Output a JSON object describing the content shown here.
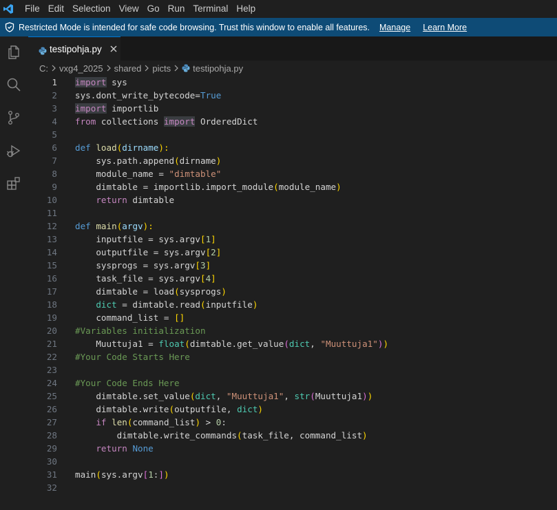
{
  "menubar": {
    "items": [
      "File",
      "Edit",
      "Selection",
      "View",
      "Go",
      "Run",
      "Terminal",
      "Help"
    ]
  },
  "banner": {
    "text": "Restricted Mode is intended for safe code browsing. Trust this window to enable all features.",
    "manage": "Manage",
    "learn_more": "Learn More"
  },
  "tab": {
    "label": "testipohja.py"
  },
  "breadcrumb": {
    "items": [
      "C:",
      "vxg4_2025",
      "shared",
      "picts"
    ],
    "file": "testipohja.py"
  },
  "editor": {
    "active_line": 1,
    "lines": [
      {
        "n": "1",
        "tokens": [
          [
            "kwhl",
            "import"
          ],
          [
            "plain",
            " sys"
          ]
        ]
      },
      {
        "n": "2",
        "tokens": [
          [
            "plain",
            "sys.dont_write_bytecode="
          ],
          [
            "kw2",
            "True"
          ]
        ]
      },
      {
        "n": "3",
        "tokens": [
          [
            "kwhl",
            "import"
          ],
          [
            "plain",
            " importlib"
          ]
        ]
      },
      {
        "n": "4",
        "tokens": [
          [
            "kw",
            "from"
          ],
          [
            "plain",
            " collections "
          ],
          [
            "kwhl",
            "import"
          ],
          [
            "plain",
            " OrderedDict"
          ]
        ]
      },
      {
        "n": "5",
        "tokens": []
      },
      {
        "n": "6",
        "tokens": [
          [
            "def",
            "def"
          ],
          [
            "plain",
            " "
          ],
          [
            "fn",
            "load"
          ],
          [
            "p1",
            "("
          ],
          [
            "var",
            "dirname"
          ],
          [
            "p1",
            "):"
          ]
        ]
      },
      {
        "n": "7",
        "tokens": [
          [
            "plain",
            "    sys.path.append"
          ],
          [
            "p1",
            "("
          ],
          [
            "plain",
            "dirname"
          ],
          [
            "p1",
            ")"
          ]
        ]
      },
      {
        "n": "8",
        "tokens": [
          [
            "plain",
            "    module_name = "
          ],
          [
            "str",
            "\"dimtable\""
          ]
        ]
      },
      {
        "n": "9",
        "tokens": [
          [
            "plain",
            "    dimtable = importlib.import_module"
          ],
          [
            "p1",
            "("
          ],
          [
            "plain",
            "module_name"
          ],
          [
            "p1",
            ")"
          ]
        ]
      },
      {
        "n": "10",
        "tokens": [
          [
            "plain",
            "    "
          ],
          [
            "kw",
            "return"
          ],
          [
            "plain",
            " dimtable"
          ]
        ]
      },
      {
        "n": "11",
        "tokens": []
      },
      {
        "n": "12",
        "tokens": [
          [
            "def",
            "def"
          ],
          [
            "plain",
            " "
          ],
          [
            "fn",
            "main"
          ],
          [
            "p1",
            "("
          ],
          [
            "var",
            "argv"
          ],
          [
            "p1",
            "):"
          ]
        ]
      },
      {
        "n": "13",
        "tokens": [
          [
            "plain",
            "    inputfile = sys.argv"
          ],
          [
            "p1",
            "["
          ],
          [
            "num",
            "1"
          ],
          [
            "p1",
            "]"
          ]
        ]
      },
      {
        "n": "14",
        "tokens": [
          [
            "plain",
            "    outputfile = sys.argv"
          ],
          [
            "p1",
            "["
          ],
          [
            "num",
            "2"
          ],
          [
            "p1",
            "]"
          ]
        ]
      },
      {
        "n": "15",
        "tokens": [
          [
            "plain",
            "    sysprogs = sys.argv"
          ],
          [
            "p1",
            "["
          ],
          [
            "num",
            "3"
          ],
          [
            "p1",
            "]"
          ]
        ]
      },
      {
        "n": "16",
        "tokens": [
          [
            "plain",
            "    task_file = sys.argv"
          ],
          [
            "p1",
            "["
          ],
          [
            "num",
            "4"
          ],
          [
            "p1",
            "]"
          ]
        ]
      },
      {
        "n": "17",
        "tokens": [
          [
            "plain",
            "    dimtable = load"
          ],
          [
            "p1",
            "("
          ],
          [
            "plain",
            "sysprogs"
          ],
          [
            "p1",
            ")"
          ]
        ]
      },
      {
        "n": "18",
        "tokens": [
          [
            "plain",
            "    "
          ],
          [
            "builtin",
            "dict"
          ],
          [
            "plain",
            " = dimtable.read"
          ],
          [
            "p1",
            "("
          ],
          [
            "plain",
            "inputfile"
          ],
          [
            "p1",
            ")"
          ]
        ]
      },
      {
        "n": "19",
        "tokens": [
          [
            "plain",
            "    command_list = "
          ],
          [
            "p1",
            "[]"
          ]
        ]
      },
      {
        "n": "20",
        "tokens": [
          [
            "cm",
            "#Variables initialization"
          ]
        ]
      },
      {
        "n": "21",
        "tokens": [
          [
            "plain",
            "    Muuttuja1 = "
          ],
          [
            "builtin",
            "float"
          ],
          [
            "p1",
            "("
          ],
          [
            "plain",
            "dimtable.get_value"
          ],
          [
            "p2",
            "("
          ],
          [
            "builtin",
            "dict"
          ],
          [
            "plain",
            ", "
          ],
          [
            "str",
            "\"Muuttuja1\""
          ],
          [
            "p2",
            ")"
          ],
          [
            "p1",
            ")"
          ]
        ]
      },
      {
        "n": "22",
        "tokens": [
          [
            "cm",
            "#Your Code Starts Here"
          ]
        ]
      },
      {
        "n": "23",
        "tokens": []
      },
      {
        "n": "24",
        "tokens": [
          [
            "cm",
            "#Your Code Ends Here"
          ]
        ]
      },
      {
        "n": "25",
        "tokens": [
          [
            "plain",
            "    dimtable.set_value"
          ],
          [
            "p1",
            "("
          ],
          [
            "builtin",
            "dict"
          ],
          [
            "plain",
            ", "
          ],
          [
            "str",
            "\"Muuttuja1\""
          ],
          [
            "plain",
            ", "
          ],
          [
            "builtin",
            "str"
          ],
          [
            "p2",
            "("
          ],
          [
            "plain",
            "Muuttuja1"
          ],
          [
            "p2",
            ")"
          ],
          [
            "p1",
            ")"
          ]
        ]
      },
      {
        "n": "26",
        "tokens": [
          [
            "plain",
            "    dimtable.write"
          ],
          [
            "p1",
            "("
          ],
          [
            "plain",
            "outputfile, "
          ],
          [
            "builtin",
            "dict"
          ],
          [
            "p1",
            ")"
          ]
        ]
      },
      {
        "n": "27",
        "tokens": [
          [
            "plain",
            "    "
          ],
          [
            "kw",
            "if"
          ],
          [
            "plain",
            " "
          ],
          [
            "fn",
            "len"
          ],
          [
            "p1",
            "("
          ],
          [
            "plain",
            "command_list"
          ],
          [
            "p1",
            ")"
          ],
          [
            "plain",
            " > "
          ],
          [
            "num",
            "0"
          ],
          [
            "plain",
            ":"
          ]
        ]
      },
      {
        "n": "28",
        "tokens": [
          [
            "plain",
            "        dimtable.write_commands"
          ],
          [
            "p1",
            "("
          ],
          [
            "plain",
            "task_file, command_list"
          ],
          [
            "p1",
            ")"
          ]
        ]
      },
      {
        "n": "29",
        "tokens": [
          [
            "plain",
            "    "
          ],
          [
            "kw",
            "return"
          ],
          [
            "plain",
            " "
          ],
          [
            "kw2",
            "None"
          ]
        ]
      },
      {
        "n": "30",
        "tokens": []
      },
      {
        "n": "31",
        "tokens": [
          [
            "plain",
            "main"
          ],
          [
            "p1",
            "("
          ],
          [
            "plain",
            "sys.argv"
          ],
          [
            "p2",
            "["
          ],
          [
            "num",
            "1"
          ],
          [
            "plain",
            ":"
          ],
          [
            "p2",
            "]"
          ],
          [
            "p1",
            ")"
          ]
        ]
      },
      {
        "n": "32",
        "tokens": []
      }
    ]
  },
  "colors": {
    "banner_bg": "#0e4b76",
    "tab_accent": "#0078d4",
    "editor_bg": "#1f1f1f"
  }
}
